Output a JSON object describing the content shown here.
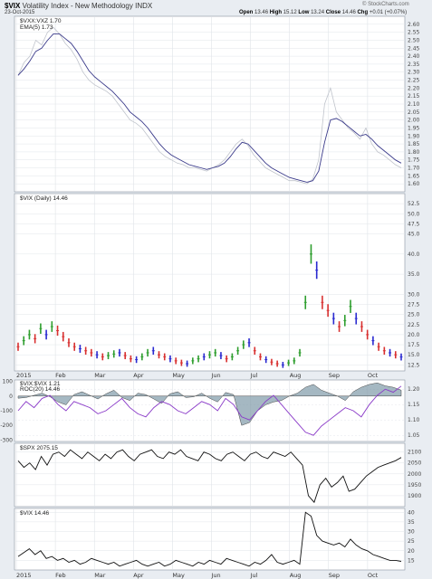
{
  "header": {
    "symbol": "$VIX",
    "name": "Volatility Index - New Methodology",
    "exchange": "INDX",
    "date": "23-Oct-2015",
    "open_label": "Open",
    "open": "13.46",
    "high_label": "High",
    "high": "15.12",
    "low_label": "Low",
    "low": "13.24",
    "close_label": "Close",
    "close": "14.46",
    "chg_label": "Chg",
    "chg": "+0.01 (+0.07%)",
    "brand": "© StockCharts.com"
  },
  "x_axis": {
    "labels": [
      "2015",
      "Feb",
      "Mar",
      "Apr",
      "May",
      "Jun",
      "Jul",
      "Aug",
      "Sep",
      "Oct"
    ]
  },
  "colors": {
    "panel_bg": "#ffffff",
    "frame_bg": "#e9edf2",
    "ratio_line": "#c0c4cc",
    "ema_line": "#3a3a8a",
    "up_bar": "#2e9e2e",
    "down_bar": "#d83030",
    "neutral_bar": "#2a2ad0",
    "rsi_purple": "#8a3ac8",
    "hist_fill": "#7f9aa8",
    "black_line": "#111111"
  },
  "chart_data": [
    {
      "type": "line",
      "panel": "ratio",
      "legend": [
        "$VXX:VXZ 1.70",
        "EMA(5) 1.73"
      ],
      "ylim": [
        1.55,
        2.65
      ],
      "y_ticks": [
        "2.60",
        "2.55",
        "2.50",
        "2.45",
        "2.40",
        "2.35",
        "2.30",
        "2.25",
        "2.20",
        "2.15",
        "2.10",
        "2.05",
        "2.00",
        "1.95",
        "1.90",
        "1.85",
        "1.80",
        "1.75",
        "1.70",
        "1.65",
        "1.60"
      ],
      "series": [
        {
          "name": "$VXX:VXZ",
          "values": [
            2.28,
            2.36,
            2.4,
            2.5,
            2.47,
            2.55,
            2.58,
            2.54,
            2.48,
            2.44,
            2.38,
            2.3,
            2.25,
            2.22,
            2.2,
            2.18,
            2.15,
            2.1,
            2.05,
            2.0,
            1.98,
            1.95,
            1.9,
            1.85,
            1.8,
            1.77,
            1.75,
            1.73,
            1.72,
            1.7,
            1.7,
            1.69,
            1.68,
            1.7,
            1.72,
            1.75,
            1.8,
            1.85,
            1.88,
            1.84,
            1.78,
            1.74,
            1.7,
            1.68,
            1.66,
            1.64,
            1.62,
            1.62,
            1.61,
            1.6,
            1.63,
            1.75,
            2.1,
            2.2,
            2.05,
            2.0,
            1.95,
            1.92,
            1.88,
            1.95,
            1.85,
            1.8,
            1.78,
            1.75,
            1.72,
            1.7
          ]
        },
        {
          "name": "EMA(5)",
          "values": [
            2.28,
            2.32,
            2.37,
            2.43,
            2.45,
            2.5,
            2.54,
            2.54,
            2.51,
            2.48,
            2.43,
            2.37,
            2.31,
            2.27,
            2.24,
            2.21,
            2.18,
            2.14,
            2.1,
            2.05,
            2.02,
            1.99,
            1.95,
            1.9,
            1.85,
            1.81,
            1.78,
            1.76,
            1.74,
            1.72,
            1.71,
            1.7,
            1.69,
            1.7,
            1.71,
            1.73,
            1.77,
            1.82,
            1.86,
            1.85,
            1.81,
            1.77,
            1.73,
            1.7,
            1.68,
            1.66,
            1.64,
            1.63,
            1.62,
            1.61,
            1.62,
            1.68,
            1.86,
            2.0,
            2.01,
            1.99,
            1.96,
            1.93,
            1.9,
            1.91,
            1.88,
            1.84,
            1.81,
            1.78,
            1.75,
            1.73
          ]
        }
      ]
    },
    {
      "type": "bar",
      "panel": "vix",
      "legend": [
        "$VIX (Daily) 14.46"
      ],
      "ylim": [
        11,
        55
      ],
      "y_ticks": [
        "52.5",
        "50.0",
        "47.5",
        "45.0",
        "40.0",
        "35.0",
        "30.0",
        "27.5",
        "25.0",
        "22.5",
        "20.0",
        "17.5",
        "15.0",
        "12.5"
      ],
      "values": [
        17.0,
        18.5,
        20.0,
        19.0,
        21.5,
        20.0,
        22.0,
        21.0,
        19.5,
        18.0,
        17.0,
        16.5,
        16.0,
        15.5,
        15.0,
        14.5,
        14.8,
        15.2,
        15.5,
        14.8,
        14.0,
        13.8,
        14.5,
        15.5,
        16.0,
        15.0,
        14.5,
        14.0,
        13.5,
        13.0,
        12.8,
        13.5,
        14.0,
        14.5,
        15.0,
        15.5,
        14.8,
        14.0,
        14.5,
        16.0,
        17.5,
        18.0,
        16.0,
        14.5,
        13.8,
        13.2,
        12.8,
        12.5,
        13.0,
        13.5,
        15.5,
        28.0,
        40.0,
        36.0,
        28.0,
        26.0,
        24.0,
        22.0,
        23.5,
        27.0,
        24.0,
        22.0,
        20.0,
        18.5,
        17.0,
        16.0,
        15.5,
        15.0,
        14.46
      ],
      "colors": [
        "d",
        "u",
        "u",
        "d",
        "u",
        "n",
        "u",
        "d",
        "d",
        "d",
        "d",
        "n",
        "d",
        "d",
        "n",
        "d",
        "u",
        "u",
        "n",
        "d",
        "d",
        "n",
        "u",
        "u",
        "n",
        "d",
        "d",
        "n",
        "d",
        "d",
        "n",
        "u",
        "u",
        "n",
        "u",
        "u",
        "n",
        "d",
        "u",
        "u",
        "u",
        "n",
        "d",
        "d",
        "n",
        "d",
        "d",
        "n",
        "u",
        "u",
        "u",
        "u",
        "u",
        "n",
        "d",
        "d",
        "n",
        "d",
        "u",
        "u",
        "n",
        "d",
        "d",
        "n",
        "d",
        "d",
        "n",
        "d",
        "n"
      ]
    },
    {
      "type": "line",
      "panel": "rsi",
      "legend": [
        "$VIX:$VIX 1.21",
        "ROC(20) 14.46"
      ],
      "ylim": [
        -310,
        110
      ],
      "y_left_ticks": [
        "100",
        "0",
        "-100",
        "-200",
        "-300"
      ],
      "y_right_ticks": [
        "1.20",
        "1.15",
        "1.10",
        "1.05"
      ],
      "series": [
        {
          "name": "$VIX:$VIX",
          "values": [
            1.13,
            1.16,
            1.14,
            1.17,
            1.18,
            1.15,
            1.13,
            1.16,
            1.15,
            1.14,
            1.12,
            1.13,
            1.15,
            1.17,
            1.14,
            1.12,
            1.11,
            1.14,
            1.16,
            1.15,
            1.13,
            1.12,
            1.14,
            1.16,
            1.15,
            1.13,
            1.17,
            1.15,
            1.11,
            1.1,
            1.13,
            1.16,
            1.18,
            1.15,
            1.12,
            1.09,
            1.06,
            1.05,
            1.08,
            1.1,
            1.12,
            1.14,
            1.13,
            1.11,
            1.15,
            1.18,
            1.2,
            1.19,
            1.21
          ]
        },
        {
          "name": "ROC(20)",
          "values": [
            -15,
            -10,
            5,
            20,
            -5,
            -40,
            -60,
            10,
            30,
            5,
            -20,
            15,
            40,
            -10,
            -30,
            20,
            10,
            -20,
            -50,
            15,
            30,
            -10,
            -5,
            20,
            -15,
            -40,
            25,
            10,
            -200,
            -180,
            -100,
            -60,
            -40,
            -30,
            0,
            20,
            60,
            80,
            40,
            20,
            0,
            -30,
            30,
            60,
            80,
            90,
            70,
            60,
            40
          ]
        }
      ]
    },
    {
      "type": "line",
      "panel": "spx",
      "legend": [
        "$SPX 2075.15"
      ],
      "ylim": [
        1850,
        2140
      ],
      "y_ticks": [
        "2100",
        "2050",
        "2000",
        "1950",
        "1900"
      ],
      "values": [
        2060,
        2030,
        2050,
        2020,
        2080,
        2040,
        2090,
        2100,
        2080,
        2110,
        2090,
        2070,
        2100,
        2080,
        2060,
        2090,
        2070,
        2100,
        2110,
        2080,
        2060,
        2090,
        2100,
        2110,
        2080,
        2070,
        2100,
        2090,
        2110,
        2080,
        2070,
        2060,
        2100,
        2090,
        2070,
        2060,
        2090,
        2100,
        2080,
        2060,
        2090,
        2100,
        2080,
        2070,
        2100,
        2090,
        2080,
        2100,
        2070,
        2040,
        1900,
        1870,
        1950,
        1980,
        1940,
        1960,
        1990,
        1920,
        1930,
        1960,
        1990,
        2010,
        2030,
        2040,
        2050,
        2060,
        2075
      ]
    },
    {
      "type": "line",
      "panel": "vix2",
      "legend": [
        "$VIX 14.46"
      ],
      "ylim": [
        10,
        42
      ],
      "y_ticks": [
        "40",
        "35",
        "30",
        "25",
        "20",
        "15"
      ],
      "values": [
        17,
        19,
        21,
        18,
        20,
        16,
        17,
        15,
        16,
        14,
        15,
        13,
        14,
        16,
        15,
        14,
        13,
        14,
        12,
        13,
        14,
        15,
        13,
        12,
        13,
        14,
        12,
        13,
        15,
        14,
        13,
        12,
        14,
        13,
        15,
        14,
        13,
        16,
        15,
        14,
        13,
        12,
        14,
        13,
        15,
        18,
        14,
        13,
        14,
        15,
        13,
        40,
        38,
        28,
        25,
        24,
        23,
        24,
        22,
        26,
        23,
        21,
        20,
        18,
        17,
        16,
        15,
        15,
        14.46
      ]
    }
  ]
}
